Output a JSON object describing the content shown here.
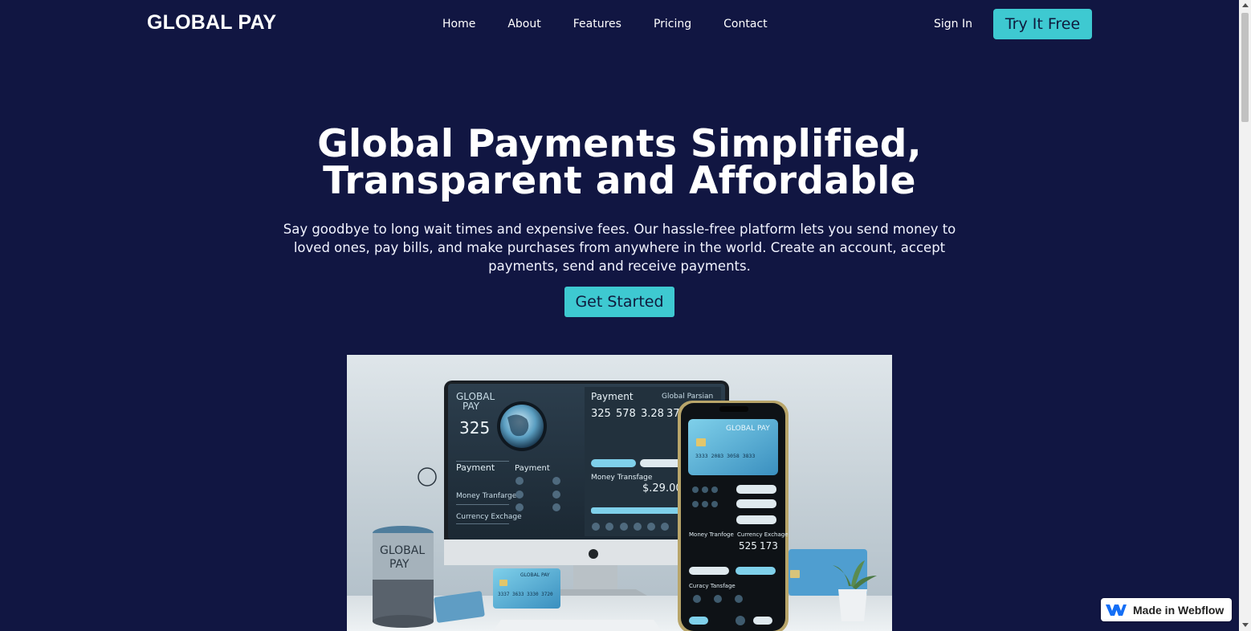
{
  "nav": {
    "brand": "GLOBAL PAY",
    "links": [
      "Home",
      "About",
      "Features",
      "Pricing",
      "Contact"
    ],
    "sign_in": "Sign In",
    "cta": "Try It Free"
  },
  "hero": {
    "title": "Global Payments Simplified, Transparent and Affordable",
    "subtitle": "Say goodbye to long wait times and expensive fees. Our hassle-free platform lets you send money to loved ones, pay bills, and make purchases from anywhere in the world. Create an account, accept payments, send and receive payments.",
    "cta": "Get Started"
  },
  "hero_image": {
    "monitor": {
      "brand_line1": "GLOBAL",
      "brand_line2": "PAY",
      "big_value": "325",
      "payment_title": "Payment",
      "global_panel": "Global Parsian",
      "values": [
        "325",
        "578",
        "3.28",
        "37"
      ],
      "menu": [
        "Payment",
        "Money Tranfarge",
        "Currency Exchage"
      ],
      "col_title": "Payment",
      "money_transfer": "Money Transfage",
      "amount": "$.29.00"
    },
    "phone": {
      "brand": "GLOBAL PAY",
      "card_number": "3333 2083 3058 3833",
      "section_left": "Money Tranfoge",
      "section_right": "Currency Exchage",
      "values": [
        "525",
        "173"
      ],
      "currency_title": "Curacy Tansfage"
    },
    "mug_line1": "GLOBAL",
    "mug_line2": "PAY",
    "card_brand": "GLOBAL PAY",
    "card_number": "3337 3633 3330 3720"
  },
  "badge": {
    "label": "Made in Webflow"
  },
  "colors": {
    "background": "#111642",
    "accent": "#3ec9d1"
  }
}
